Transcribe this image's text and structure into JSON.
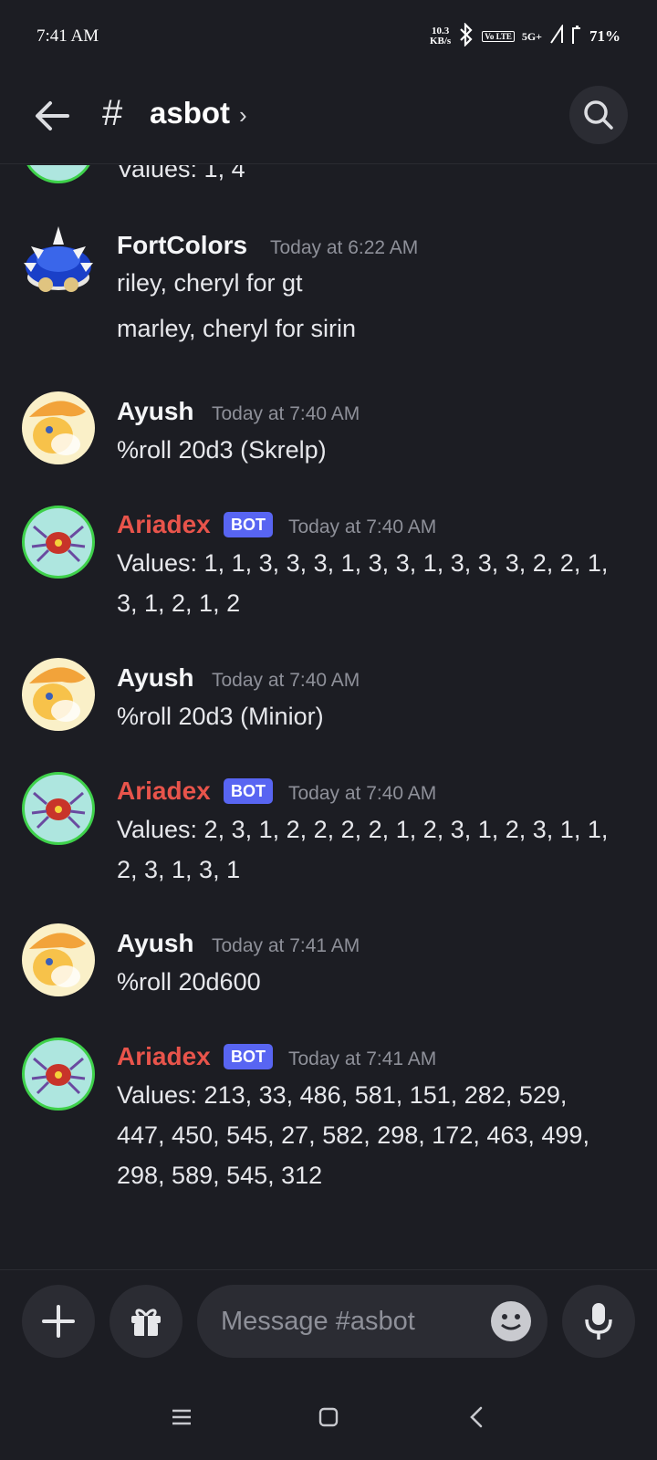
{
  "status": {
    "time": "7:41 AM",
    "net_speed_top": "10.3",
    "net_speed_bottom": "KB/s",
    "volte": "Vo LTE",
    "network": "5G+",
    "battery": "71%"
  },
  "header": {
    "channel": "asbot"
  },
  "messages": [
    {
      "text": "Values: 1, 4"
    },
    {
      "author": "FortColors",
      "timestamp": "Today at 6:22 AM",
      "lines": [
        "riley, cheryl for gt",
        "marley, cheryl for sirin"
      ]
    },
    {
      "author": "Ayush",
      "timestamp": "Today at 7:40 AM",
      "text": "%roll 20d3 (Skrelp)"
    },
    {
      "author": "Ariadex",
      "badge": "BOT",
      "timestamp": "Today at 7:40 AM",
      "lines": [
        "Values: 1, 1, 3, 3, 3, 1, 3, 3, 1, 3, 3, 3, 2, 2, 1,",
        "3, 1, 2, 1, 2"
      ]
    },
    {
      "author": "Ayush",
      "timestamp": "Today at 7:40 AM",
      "text": "%roll 20d3 (Minior)"
    },
    {
      "author": "Ariadex",
      "badge": "BOT",
      "timestamp": "Today at 7:40 AM",
      "lines": [
        "Values: 2, 3, 1, 2, 2, 2, 2, 1, 2, 3, 1, 2, 3, 1, 1,",
        "2, 3, 1, 3, 1"
      ]
    },
    {
      "author": "Ayush",
      "timestamp": "Today at 7:41 AM",
      "text": "%roll 20d600"
    },
    {
      "author": "Ariadex",
      "badge": "BOT",
      "timestamp": "Today at 7:41 AM",
      "lines": [
        "Values: 213, 33, 486, 581, 151, 282, 529,",
        "447, 450, 545, 27, 582, 298, 172, 463, 499,",
        "298, 589, 545, 312"
      ]
    }
  ],
  "composer": {
    "placeholder": "Message #asbot"
  },
  "colors": {
    "background": "#1c1d23",
    "bot_name": "#e8544b",
    "bot_badge": "#5865f2",
    "timestamp": "#8e9099"
  },
  "icons": [
    "arrow-left-icon",
    "hash-icon",
    "chevron-right-icon",
    "search-icon",
    "plus-icon",
    "gift-icon",
    "emoji-icon",
    "microphone-icon",
    "menu-icon",
    "home-square-icon",
    "back-chevron-icon"
  ]
}
